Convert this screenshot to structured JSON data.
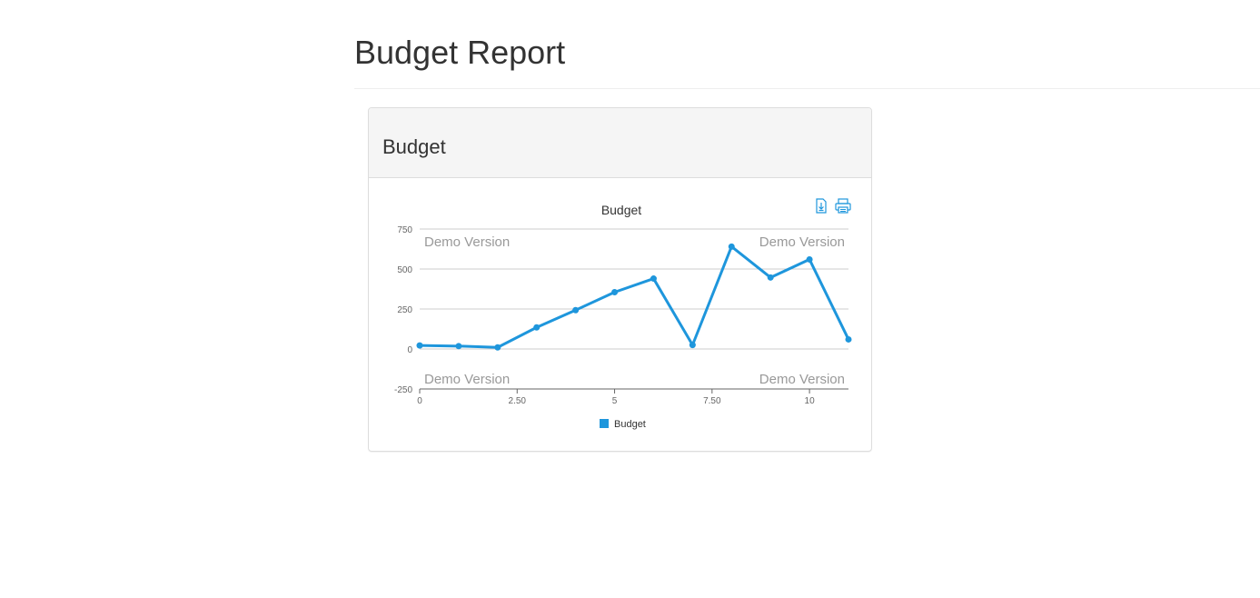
{
  "page": {
    "title": "Budget Report"
  },
  "panel": {
    "title": "Budget"
  },
  "chart_data": {
    "type": "line",
    "title": "Budget",
    "x": [
      0,
      1,
      2,
      3,
      4,
      5,
      6,
      7,
      8,
      9,
      10,
      11
    ],
    "series": [
      {
        "name": "Budget",
        "values": [
          22,
          18,
          10,
          135,
          243,
          355,
          440,
          25,
          640,
          447,
          560,
          60
        ]
      }
    ],
    "xlim": [
      0,
      11
    ],
    "ylim": [
      -250,
      750
    ],
    "y_ticks": [
      "750",
      "500",
      "250",
      "0",
      "-250"
    ],
    "y_tick_values": [
      750,
      500,
      250,
      0,
      -250
    ],
    "x_ticks": [
      "0",
      "2.50",
      "5",
      "7.50",
      "10"
    ],
    "x_tick_values": [
      0,
      2.5,
      5,
      7.5,
      10
    ],
    "grid": true,
    "legend_position": "bottom-center",
    "color": "#1e96dc",
    "watermark": "Demo Version",
    "toolbar": {
      "export_icon": "download-icon",
      "print_icon": "printer-icon"
    }
  }
}
